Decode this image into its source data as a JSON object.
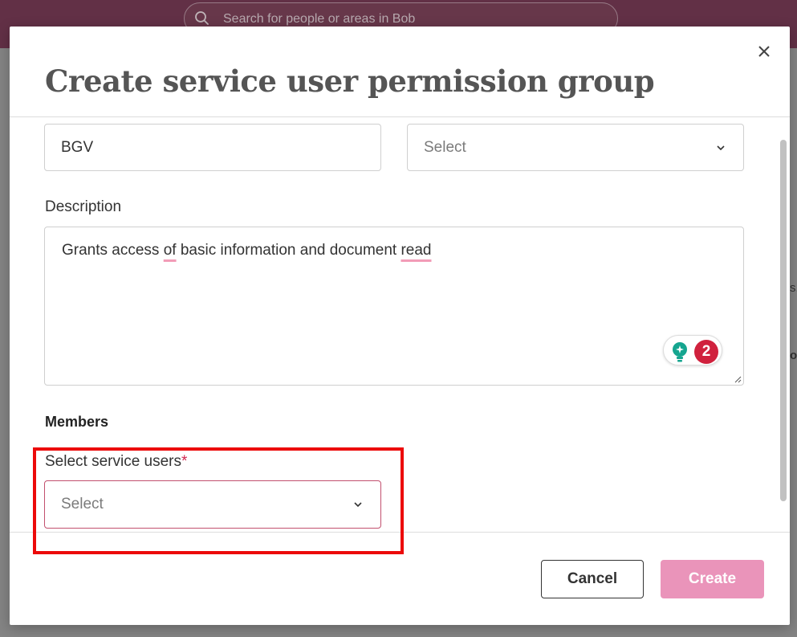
{
  "topbar": {
    "search_placeholder": "Search for people or areas in Bob"
  },
  "background": {
    "edge_text_1": "s.",
    "edge_text_2": "o"
  },
  "modal": {
    "title": "Create service user permission group",
    "name_field": {
      "value": "BGV"
    },
    "type_field": {
      "placeholder": "Select"
    },
    "description": {
      "label": "Description",
      "text_parts": [
        "Grants access ",
        "of",
        " basic information and document ",
        "read"
      ]
    },
    "grammarly": {
      "count": "2"
    },
    "members": {
      "heading": "Members",
      "service_users_label": "Select service users",
      "required_mark": "*",
      "service_users_placeholder": "Select"
    },
    "buttons": {
      "cancel": "Cancel",
      "create": "Create"
    }
  },
  "colors": {
    "topbar": "#560a2b",
    "create_button": "#ea94ba",
    "highlight": "#ec0a0a",
    "required": "#d1274f",
    "grammarly_badge": "#d0213d",
    "grammarly_bulb": "#15a58f"
  }
}
